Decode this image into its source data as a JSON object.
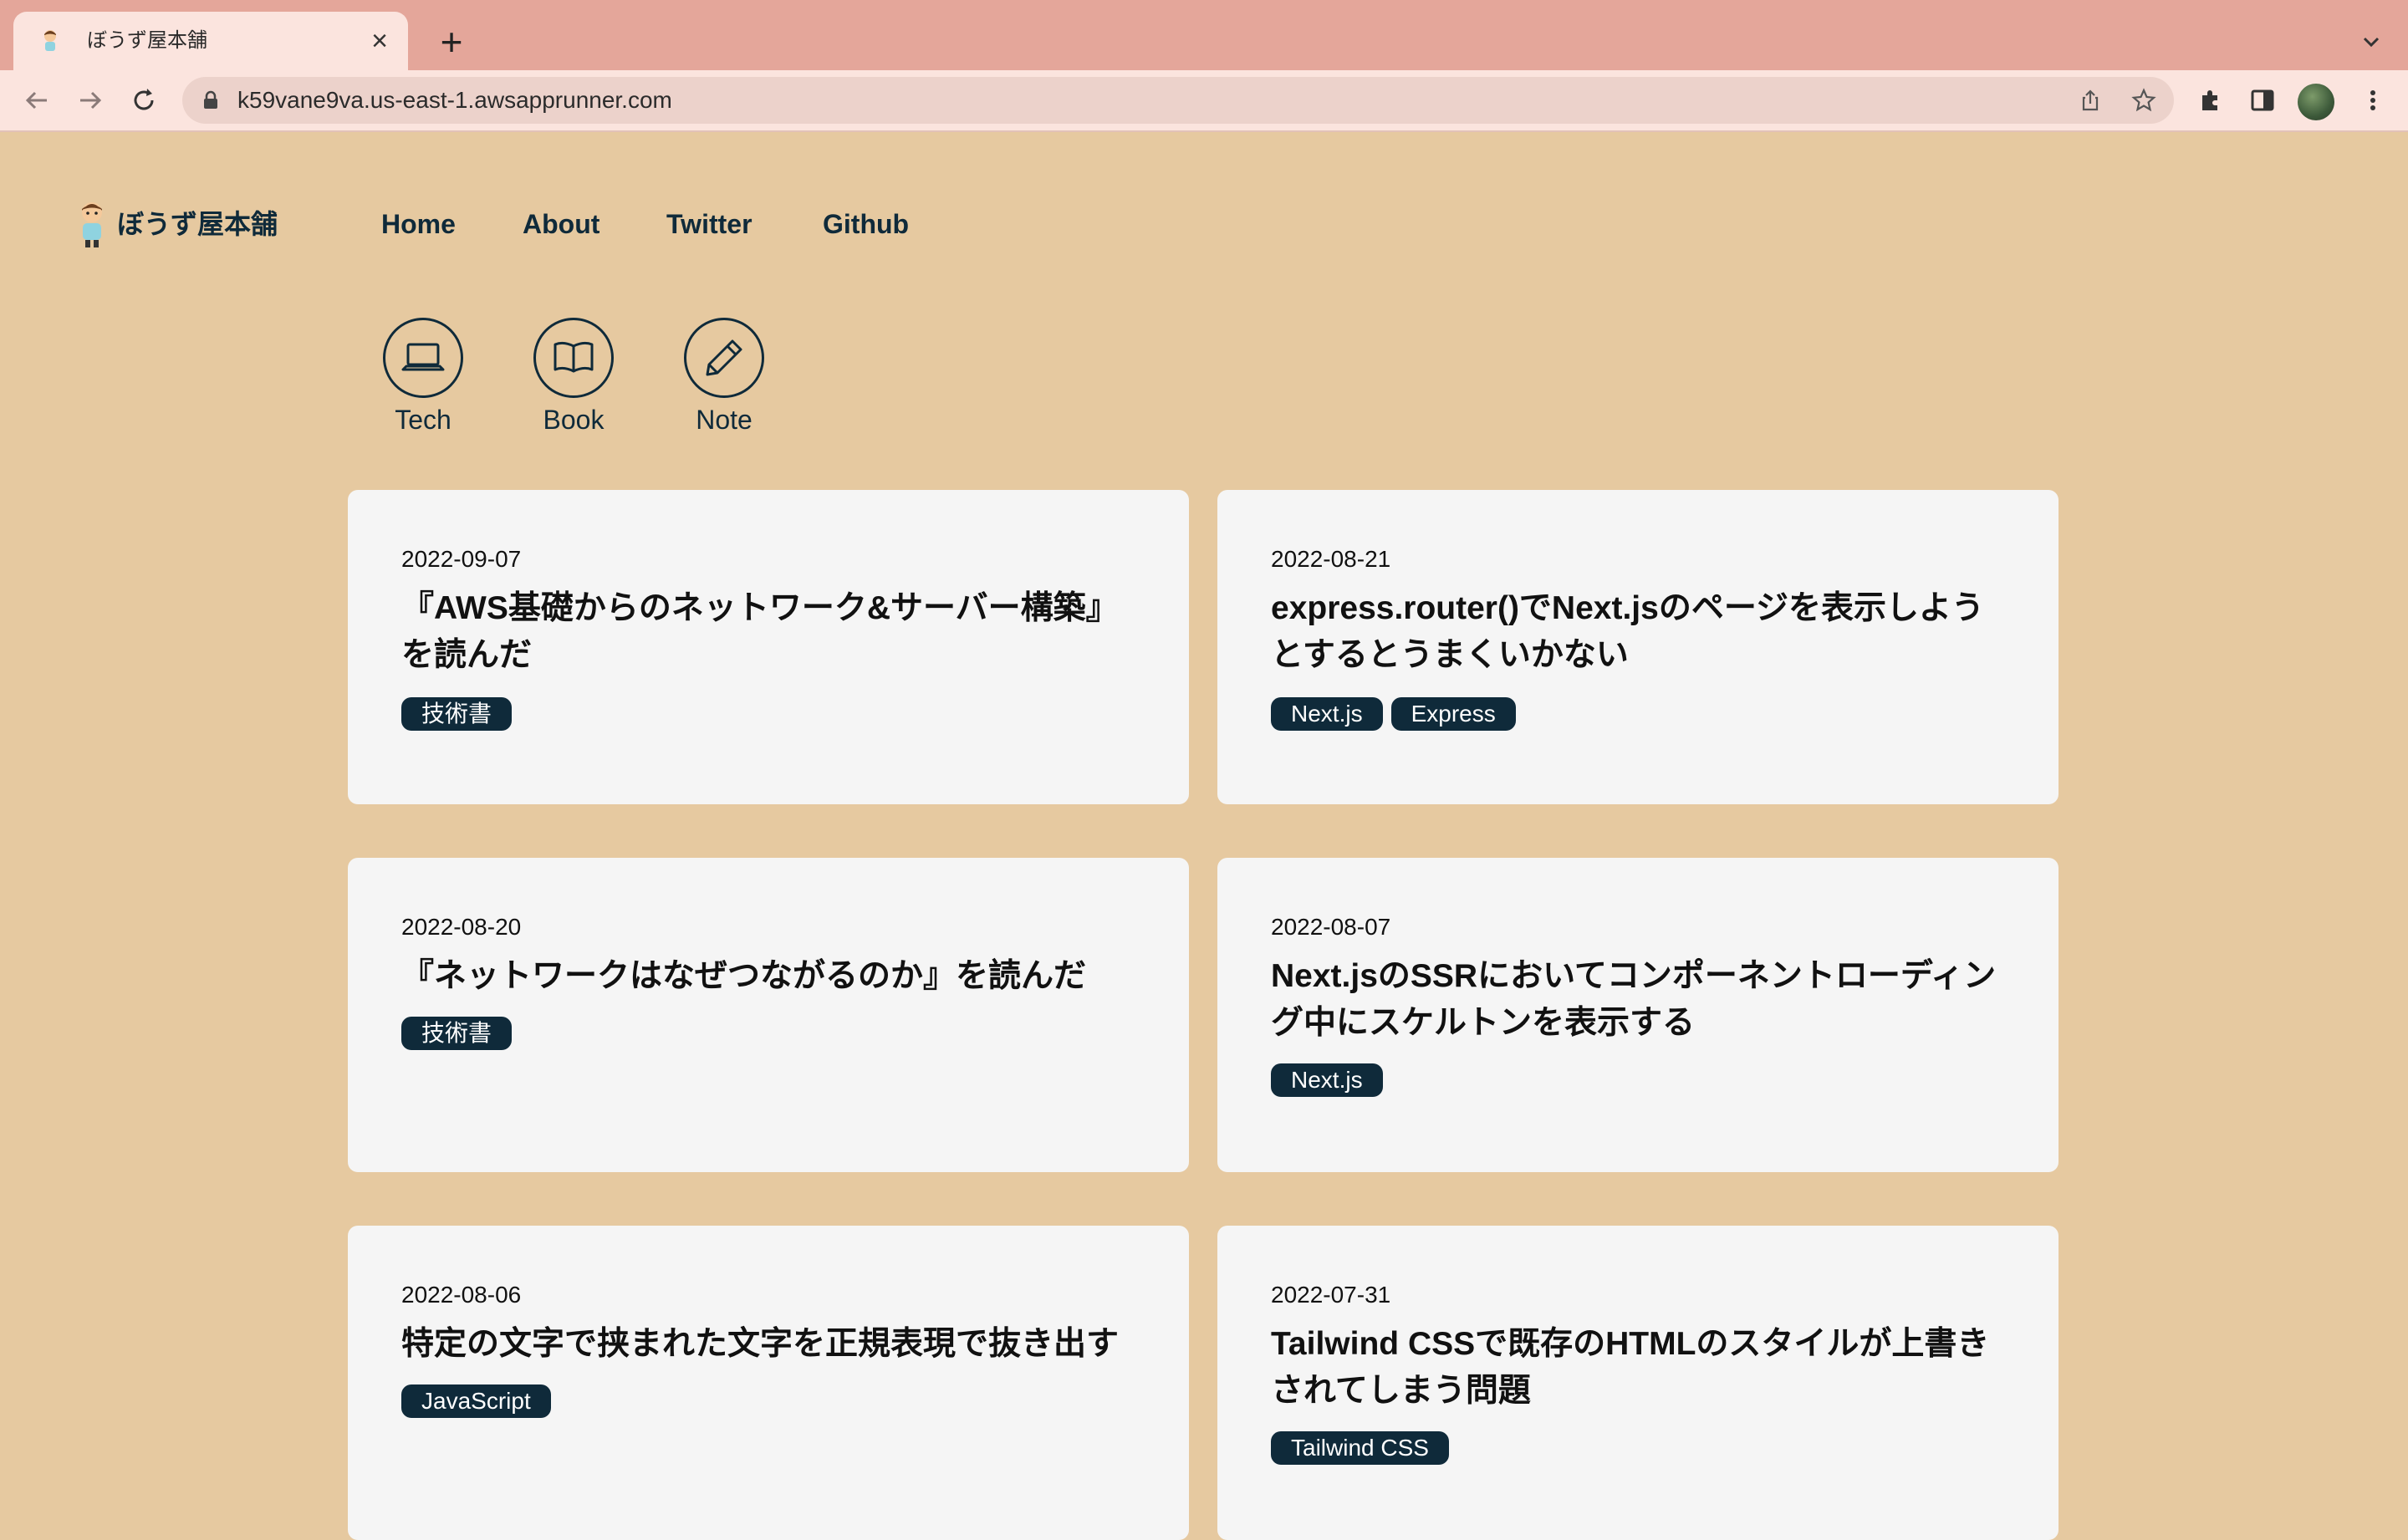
{
  "browser": {
    "tab_title": "ぼうず屋本舗",
    "url": "k59vane9va.us-east-1.awsapprunner.com"
  },
  "site": {
    "name": "ぼうず屋本舗",
    "nav": [
      "Home",
      "About",
      "Twitter",
      "Github"
    ]
  },
  "categories": [
    {
      "label": "Tech",
      "icon": "laptop-icon"
    },
    {
      "label": "Book",
      "icon": "book-icon"
    },
    {
      "label": "Note",
      "icon": "pencil-icon"
    }
  ],
  "posts": [
    {
      "date": "2022-09-07",
      "title": "『AWS基礎からのネットワーク&サーバー構築』を読んだ",
      "tags": [
        "技術書"
      ]
    },
    {
      "date": "2022-08-21",
      "title": "express.router()でNext.jsのページを表示しようとするとうまくいかない",
      "tags": [
        "Next.js",
        "Express"
      ]
    },
    {
      "date": "2022-08-20",
      "title": "『ネットワークはなぜつながるのか』を読んだ",
      "tags": [
        "技術書"
      ]
    },
    {
      "date": "2022-08-07",
      "title": "Next.jsのSSRにおいてコンポーネントローディング中にスケルトンを表示する",
      "tags": [
        "Next.js"
      ]
    },
    {
      "date": "2022-08-06",
      "title": "特定の文字で挟まれた文字を正規表現で抜き出す",
      "tags": [
        "JavaScript"
      ]
    },
    {
      "date": "2022-07-31",
      "title": "Tailwind CSSで既存のHTMLのスタイルが上書きされてしまう問題",
      "tags": [
        "Tailwind CSS"
      ]
    }
  ],
  "colors": {
    "page_bg": "#e6c9a0",
    "card_bg": "#f5f5f5",
    "accent": "#0f2a3a",
    "tabstrip": "#e4a69a"
  }
}
